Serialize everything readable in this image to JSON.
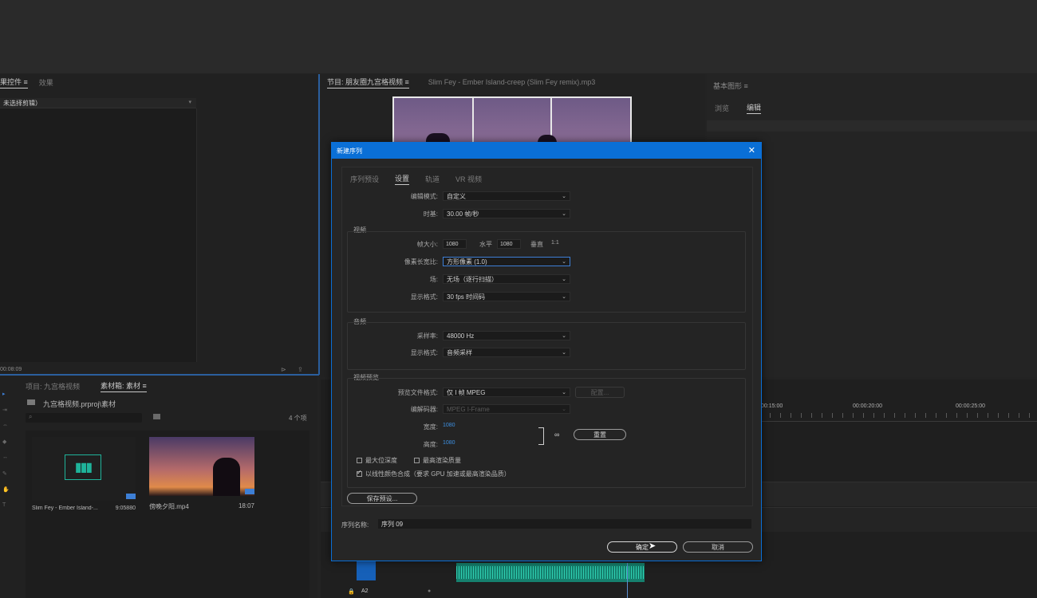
{
  "source_panel": {
    "tabs": [
      "果控件 ≡",
      "效果"
    ],
    "clip_status": "未选择剪辑）",
    "timecode": "00:08:09"
  },
  "program_panel": {
    "tabs": [
      "节目: 朋友圈九宫格视频 ≡",
      "Slim Fey - Ember Island-creep (Slim Fey remix).mp3"
    ]
  },
  "graphics_panel": {
    "title": "基本图形 ≡",
    "tabs": [
      "浏览",
      "编辑"
    ]
  },
  "project_panel": {
    "tabs": [
      "项目: 九宫格视频",
      "素材箱: 素材 ≡"
    ],
    "path": "九宫格视频.prproj\\素材",
    "item_count": "4 个项",
    "items": [
      {
        "name": "Slim Fey - Ember Island-...",
        "duration": "9:05880"
      },
      {
        "name": "傍晚夕阳.mp4",
        "duration": "18:07"
      }
    ]
  },
  "timeline": {
    "ruler": [
      "00:15:00",
      "00:00:20:00",
      "00:00:25:00"
    ],
    "track_label": "A2"
  },
  "dialog": {
    "title": "新建序列",
    "close_label": "✕",
    "tabs": [
      "序列预设",
      "设置",
      "轨道",
      "VR 视频"
    ],
    "edit_mode": {
      "label": "编辑模式:",
      "value": "自定义"
    },
    "timebase": {
      "label": "时基:",
      "value": "30.00  帧/秒"
    },
    "video": {
      "title": "视频",
      "frame_size_label": "帧大小:",
      "width": "1080",
      "horizontal_label": "水平",
      "height": "1080",
      "vertical_label": "垂直",
      "aspect": "1:1",
      "pixel_aspect": {
        "label": "像素长宽比:",
        "value": "方形像素 (1.0)"
      },
      "fields": {
        "label": "场:",
        "value": "无场（逐行扫描）"
      },
      "display_format": {
        "label": "显示格式:",
        "value": "30 fps 时间码"
      }
    },
    "audio": {
      "title": "音频",
      "sample_rate": {
        "label": "采样率:",
        "value": "48000 Hz"
      },
      "display_format": {
        "label": "显示格式:",
        "value": "音频采样"
      }
    },
    "preview": {
      "title": "视频预览",
      "file_format": {
        "label": "预览文件格式:",
        "value": "仅 I 帧 MPEG"
      },
      "config_label": "配置...",
      "codec": {
        "label": "编解码器:",
        "value": "MPEG I-Frame"
      },
      "width": {
        "label": "宽度:",
        "value": "1080"
      },
      "height": {
        "label": "高度:",
        "value": "1080"
      },
      "reset_label": "重置",
      "max_bit_depth": "最大位深度",
      "max_render_quality": "最高渲染质量",
      "linear_color": "以线性颜色合成（要求 GPU 加速或最高渲染品质）"
    },
    "save_preset_label": "保存预设...",
    "sequence_name": {
      "label": "序列名称:",
      "value": "序列 09"
    },
    "ok_label": "确定",
    "cancel_label": "取消"
  },
  "colors": {
    "accent_blue": "#0a6fd6",
    "waveform_teal": "#1fb39a"
  }
}
